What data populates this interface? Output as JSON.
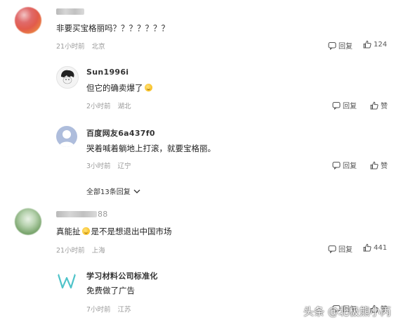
{
  "comments": [
    {
      "username": "",
      "content": "非要买宝格丽吗？？？？？？？",
      "time": "21小时前",
      "location": "北京",
      "reply_label": "回复",
      "likes": "124"
    },
    {
      "username": "Sun1996i",
      "content_before": "但它的确卖爆了",
      "content_after": "",
      "time": "2小时前",
      "location": "湖北",
      "reply_label": "回复",
      "like_label": "赞"
    },
    {
      "username": "百度网友6a437f0",
      "content": "哭着喊着躺地上打滚，就要宝格丽。",
      "time": "3小时前",
      "location": "辽宁",
      "reply_label": "回复",
      "like_label": "赞"
    },
    {
      "username": "88",
      "content_before": "真能扯",
      "content_after": "是不是想退出中国市场",
      "time": "21小时前",
      "location": "上海",
      "reply_label": "回复",
      "likes": "441"
    },
    {
      "username": "学习材料公司标准化",
      "content": "免费做了广告",
      "time": "7小时前",
      "location": "江苏",
      "reply_label": "回复",
      "like_label": "赞"
    }
  ],
  "expand_replies": "全部13条回复",
  "watermark": "头条 @北极熊小丙"
}
